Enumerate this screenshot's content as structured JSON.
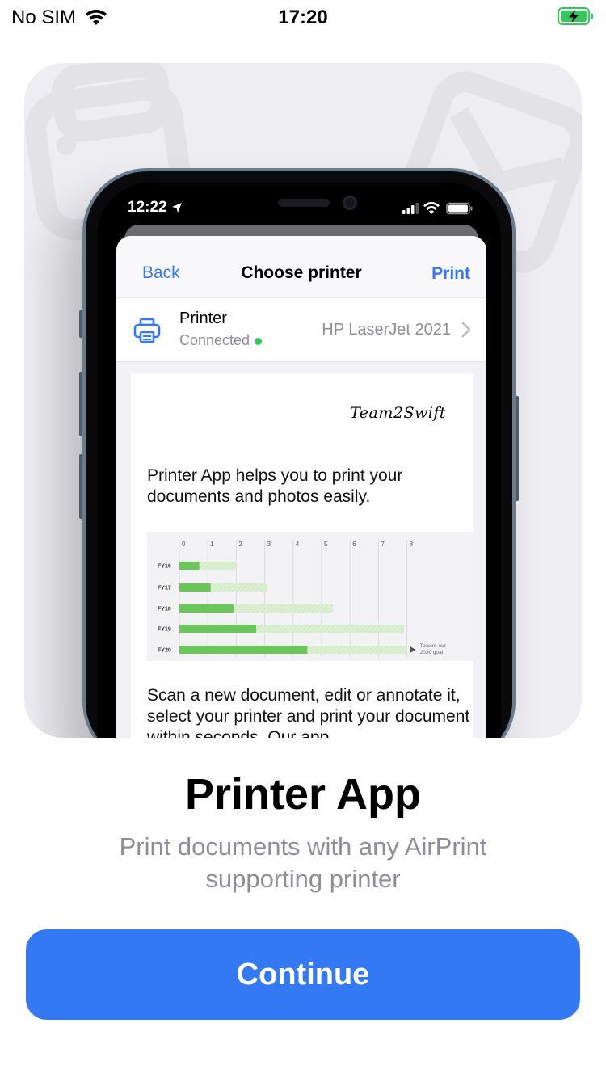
{
  "status_bar": {
    "carrier": "No SIM",
    "time": "17:20",
    "icons": [
      "wifi-icon",
      "battery-charging-icon"
    ],
    "battery_color": "#34c759"
  },
  "preview": {
    "phone_status": {
      "time": "12:22",
      "icons": [
        "location-arrow-icon",
        "signal-icon",
        "wifi-icon",
        "battery-icon"
      ]
    },
    "nav": {
      "back": "Back",
      "title": "Choose printer",
      "action": "Print"
    },
    "printer_row": {
      "label": "Printer",
      "status": "Connected",
      "value": "HP LaserJet 2021",
      "icon": "printer-icon"
    },
    "document": {
      "brand": "Team2Swift",
      "paragraph1": "Printer App helps you to print your documents and photos easily.",
      "paragraph2": "Scan a new document, edit or annotate it, select your printer and print your document within seconds. Our app"
    }
  },
  "chart_data": {
    "type": "bar",
    "categories": [
      "FY16",
      "FY17",
      "FY18",
      "FY19",
      "FY20"
    ],
    "series": [
      {
        "values": [
          0.7,
          1.1,
          1.9,
          2.7,
          4.5
        ]
      },
      {
        "values": [
          2.0,
          3.1,
          5.4,
          7.9,
          8.0
        ]
      }
    ],
    "xticks": [
      "0",
      "1",
      "2",
      "3",
      "4",
      "5",
      "6",
      "7",
      "8"
    ],
    "xlim": [
      0,
      8
    ],
    "annotation": "Toward our 2030 goal",
    "colors": {
      "actual": "#6cc75a",
      "goal": "#d5ecc9"
    },
    "orientation": "horizontal"
  },
  "onboarding": {
    "title": "Printer App",
    "subtitle": "Print documents with any AirPrint supporting printer",
    "button": "Continue",
    "accent": "#3479f4"
  }
}
